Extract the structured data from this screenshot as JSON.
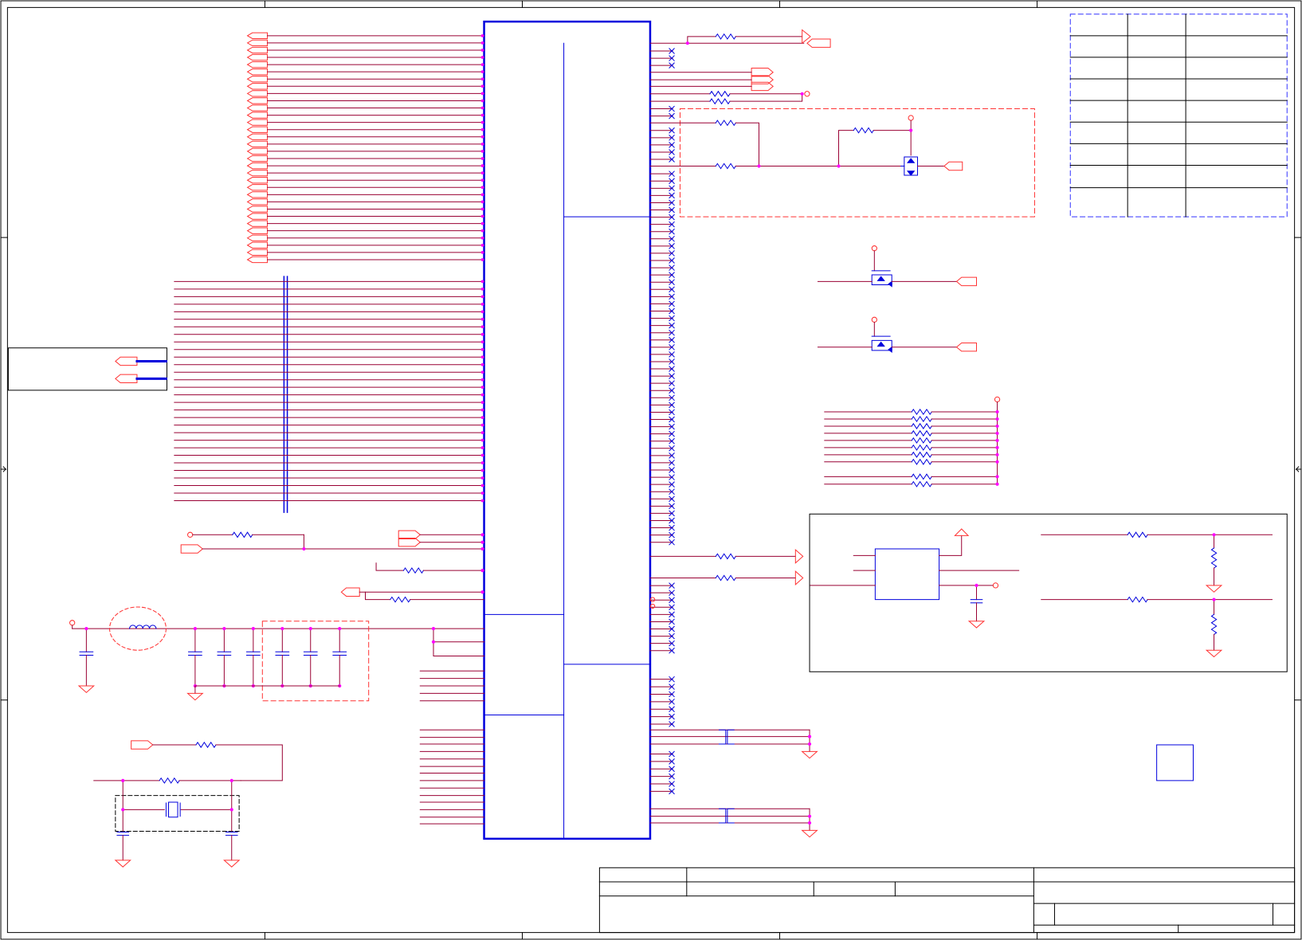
{
  "sheet": {
    "kind": "electronic schematic sheet",
    "colors": {
      "frame": "#000000",
      "wire": "#990033",
      "net_red": "#ff3333",
      "component_blue": "#0000dd",
      "junction": "#ff00ff",
      "dashed_group_red": "#ff3333",
      "dashed_group_blue": "#3333ff",
      "dashed_group_black": "#000000"
    },
    "grid_columns": 5,
    "grid_rows": 4
  },
  "parts": {
    "main_ic": {
      "icon": "ic-package"
    },
    "mosfets": {
      "count": 3,
      "icon": "mosfet-symbol"
    },
    "resistor_network": {
      "count": 10,
      "icon": "resistor-symbol"
    },
    "bus_left": {
      "count": 30
    },
    "off_page_connectors": {
      "icon": "off-page-connector"
    },
    "crystal": {
      "icon": "crystal-symbol"
    },
    "ferrite": {
      "icon": "inductor-symbol"
    }
  }
}
